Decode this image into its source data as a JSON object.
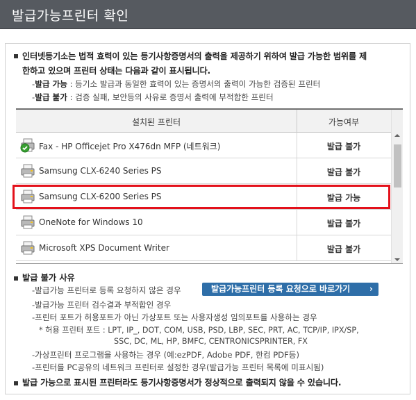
{
  "window": {
    "title": "발급가능프린터 확인"
  },
  "notice": {
    "line1": "인터넷등기소는 법적 효력이 있는 등기사항증명서의 출력을 제공하기 위하여 발급 가능한 범위를 제",
    "line2": "한하고 있으며 프린터 상태는 다음과 같이 표시됩니다.",
    "legend": [
      {
        "term": "발급 가능",
        "desc": " : 등기소 발급과 동일한 효력이 있는 증명서의 출력이 가능한 검증된 프린터"
      },
      {
        "term": "발급 불가",
        "desc": " : 검증 실패, 보안등의 사유로 증명서 출력에 부적합한 프린터"
      }
    ]
  },
  "table": {
    "headers": {
      "printer": "설치된 프린터",
      "status": "가능여부"
    },
    "rows": [
      {
        "name": "Fax - HP Officejet Pro X476dn MFP (네트워크)",
        "status": "발급 불가",
        "icon": "fax-printer-default-icon"
      },
      {
        "name": "Samsung CLX-6240 Series PS",
        "status": "발급 불가",
        "icon": "printer-icon"
      },
      {
        "name": "Samsung CLX-6200 Series PS",
        "status": "발급 가능",
        "icon": "printer-icon"
      },
      {
        "name": "OneNote for Windows 10",
        "status": "발급 불가",
        "icon": "printer-icon"
      },
      {
        "name": "Microsoft XPS Document Writer",
        "status": "발급 불가",
        "icon": "printer-icon"
      }
    ]
  },
  "reasons": {
    "title": "발급 불가 사유",
    "items": [
      "-발급가능 프린터로 등록 요청하지 않은 경우",
      "-발급가능 프린터 검수결과 부적합인 경우",
      "-프린터 포트가 허용포트가 아닌 가상포트 또는 사용자생성 임의포트를 사용하는 경우",
      "* 허용 프린터 포트 : LPT, IP_, DOT, COM, USB, PSD, LBP, SEC, PRT, AC, TCP/IP, IPX/SP,",
      "SSC, DC, ML, HP, BMFC, CENTRONICSPRINTER, FX",
      "-가상프린터 프로그램을 사용하는 경우 (예:ezPDF, Adobe PDF, 한컴 PDF등)",
      "-프린터를 PC공유의 네트워크 프린터로 설정한 경우(발급가능 프린터 목록에 미표시됨)"
    ],
    "register_button": "발급가능프린터 등록 요청으로 바로가기"
  },
  "footer_notice": "발급 가능으로 표시된 프린터라도 등기사항증명서가 정상적으로 출력되지 않을 수 있습니다.",
  "colors": {
    "highlight": "#e3111b",
    "titlebar": "#565a60",
    "button": "#2e6ea8"
  }
}
